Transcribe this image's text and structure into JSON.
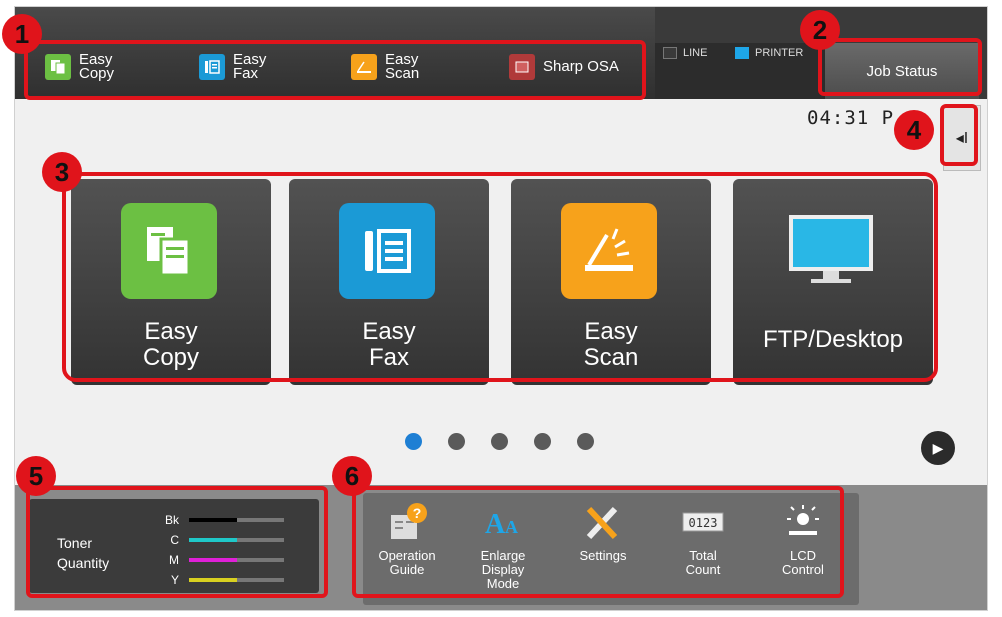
{
  "quick_bar": [
    {
      "line1": "Easy",
      "line2": "Copy",
      "icon": "copy-icon",
      "color": "#6cc043"
    },
    {
      "line1": "Easy",
      "line2": "Fax",
      "icon": "fax-icon",
      "color": "#1b9ad6"
    },
    {
      "line1": "Easy",
      "line2": "Scan",
      "icon": "scan-icon",
      "color": "#f7a21b"
    },
    {
      "line1": "Sharp OSA",
      "line2": "",
      "icon": "osa-icon",
      "color": "#b03a3a"
    }
  ],
  "indicators": {
    "line": "LINE",
    "printer": "PRINTER",
    "line_color": "#3a3a3a",
    "printer_color": "#1ea6e8"
  },
  "job_status": "Job Status",
  "clock": "04:31 P",
  "side_toggle": "◂I",
  "tiles": [
    {
      "line1": "Easy",
      "line2": "Copy",
      "icon": "copy-icon",
      "color": "#6cc043"
    },
    {
      "line1": "Easy",
      "line2": "Fax",
      "icon": "fax-icon",
      "color": "#1b9ad6"
    },
    {
      "line1": "Easy",
      "line2": "Scan",
      "icon": "scan-icon",
      "color": "#f7a21b"
    },
    {
      "line1": "FTP/Desktop",
      "line2": "",
      "icon": "monitor-icon",
      "color": "#29b7e6"
    }
  ],
  "pager": {
    "pages": 5,
    "current": 1
  },
  "toner": {
    "title_line1": "Toner",
    "title_line2": "Quantity",
    "rows": [
      {
        "label": "Bk",
        "level": 0.5,
        "color": "#000000"
      },
      {
        "label": "C",
        "level": 0.5,
        "color": "#1fc8c8"
      },
      {
        "label": "M",
        "level": 0.5,
        "color": "#e020d8"
      },
      {
        "label": "Y",
        "level": 0.5,
        "color": "#d8d020"
      }
    ]
  },
  "tools": [
    {
      "line1": "Operation",
      "line2": "Guide",
      "line3": "",
      "icon": "operation-guide-icon"
    },
    {
      "line1": "Enlarge",
      "line2": "Display",
      "line3": "Mode",
      "icon": "enlarge-display-icon"
    },
    {
      "line1": "Settings",
      "line2": "",
      "line3": "",
      "icon": "settings-icon"
    },
    {
      "line1": "Total",
      "line2": "Count",
      "line3": "",
      "icon": "total-count-icon"
    },
    {
      "line1": "LCD",
      "line2": "Control",
      "line3": "",
      "icon": "lcd-control-icon"
    }
  ],
  "callouts": [
    "1",
    "2",
    "3",
    "4",
    "5",
    "6"
  ],
  "accent": "#e0141b"
}
